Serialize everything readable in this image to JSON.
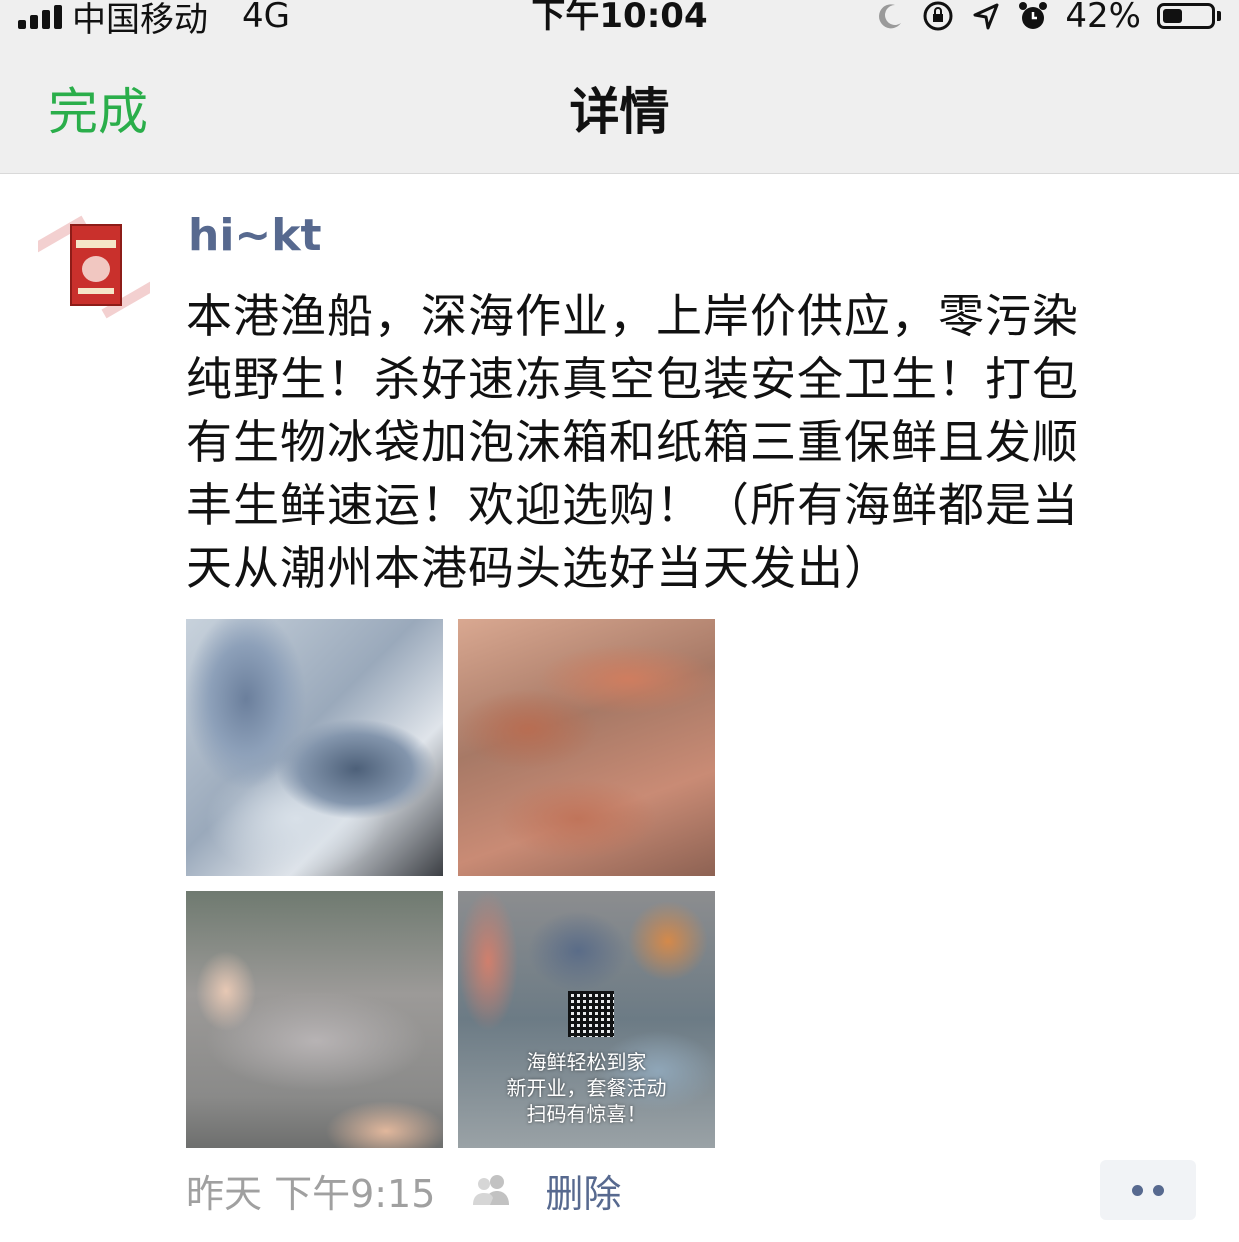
{
  "status_bar": {
    "carrier": "中国移动",
    "network": "4G",
    "time": "下午10:04",
    "battery_percent": "42%",
    "battery_level": 0.42,
    "icons": [
      "signal-icon",
      "moon-icon",
      "rotation-lock-icon",
      "location-arrow-icon",
      "alarm-icon",
      "battery-icon"
    ]
  },
  "nav": {
    "done_label": "完成",
    "title": "详情"
  },
  "post": {
    "username": "hi~kt",
    "text": "本港渔船，深海作业，上岸价供应，零污染\n纯野生！杀好速冻真空包装安全卫生！打包\n有生物冰袋加泡沫箱和纸箱三重保鲜且发顺\n丰生鲜速运！欢迎选购！（所有海鲜都是当\n天从潮州本港码头选好当天发出）",
    "photos": [
      {
        "subject": "frozen-fish-in-ice-box"
      },
      {
        "subject": "red-fish-pile"
      },
      {
        "subject": "spotted-fish-in-hand"
      },
      {
        "subject": "seafood-collage-with-qr",
        "overlay_text": "海鲜轻松到家\n新开业，套餐活动\n扫码有惊喜！"
      }
    ],
    "timestamp": "昨天 下午9:15",
    "delete_label": "删除"
  },
  "colors": {
    "accent_green": "#2aae4a",
    "link_blue": "#57698f",
    "nav_bg": "#efefef",
    "meta_gray": "#a0a0a0"
  }
}
